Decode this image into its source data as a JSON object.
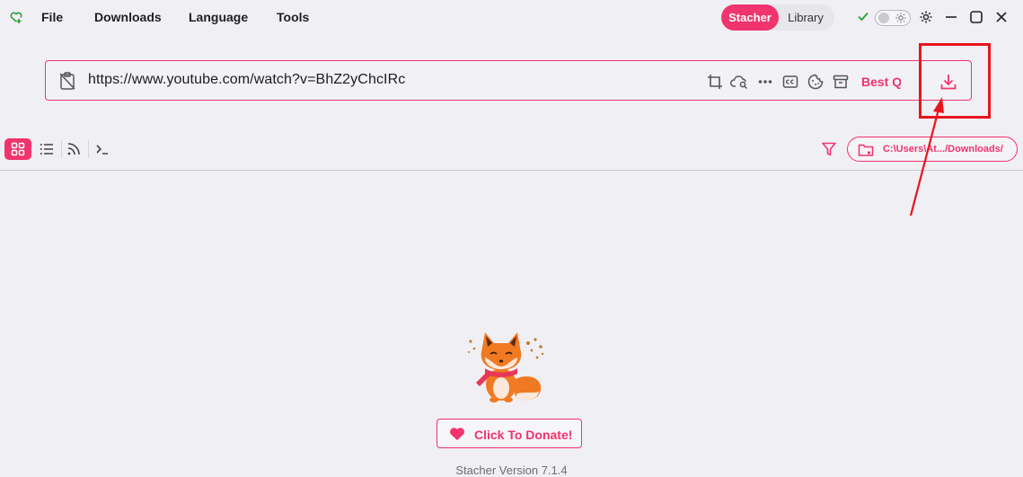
{
  "menu": {
    "file": "File",
    "downloads": "Downloads",
    "language": "Language",
    "tools": "Tools"
  },
  "mode_tabs": {
    "active": "Stacher",
    "inactive": "Library"
  },
  "url_bar": {
    "value": "https://www.youtube.com/watch?v=BhZ2yChcIRc",
    "quality_label": "Best Quality"
  },
  "output_folder": "C:\\Users\\At.../Downloads/",
  "donate_label": "Click To Donate!",
  "version_text": "Stacher Version 7.1.4",
  "colors": {
    "accent": "#f0346d",
    "annotation_red": "#e8141c",
    "check_green": "#2e9e3a"
  },
  "icons": [
    "app-logo-icon",
    "check-icon",
    "theme-toggle",
    "settings-icon",
    "minimize-icon",
    "maximize-icon",
    "close-icon",
    "clipboard-icon",
    "crop-icon",
    "cloud-search-icon",
    "more-icon",
    "captions-icon",
    "cookie-icon",
    "archive-icon",
    "download-icon",
    "grid-view-icon",
    "list-view-icon",
    "rss-icon",
    "terminal-icon",
    "filter-icon",
    "folder-settings-icon",
    "heart-icon",
    "fox-mascot"
  ]
}
